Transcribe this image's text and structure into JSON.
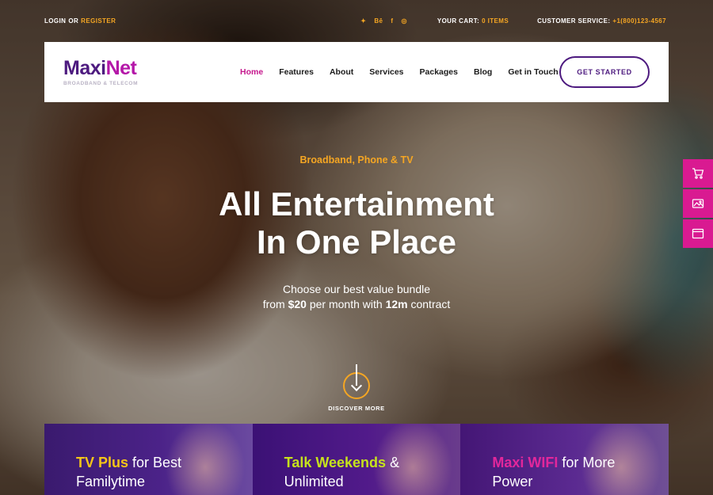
{
  "topbar": {
    "login": "LOGIN",
    "or": "OR",
    "register": "REGISTER",
    "social_icons": [
      "twitter-icon",
      "behance-icon",
      "facebook-icon",
      "instagram-icon"
    ],
    "social_glyphs": [
      "✦",
      "Bē",
      "f",
      "◎"
    ],
    "cart_label": "YOUR CART:",
    "cart_value": "0 ITEMS",
    "service_label": "CUSTOMER SERVICE:",
    "service_value": "+1(800)123-4567"
  },
  "logo": {
    "name_part1": "Maxi",
    "name_part2": "Net",
    "tagline": "BROADBAND & TELECOM"
  },
  "nav": {
    "items": [
      "Home",
      "Features",
      "About",
      "Services",
      "Packages",
      "Blog",
      "Get in Touch"
    ],
    "active": "Home",
    "cta": "GET STARTED"
  },
  "hero": {
    "eyebrow": "Broadband, Phone & TV",
    "headline_line1": "All Entertainment",
    "headline_line2": "In One Place",
    "sub_line1": "Choose our best value bundle",
    "sub_from": "from",
    "sub_price": "$20",
    "sub_mid": "per month with",
    "sub_term": "12m",
    "sub_end": "contract",
    "discover": "DISCOVER MORE"
  },
  "side_buttons": [
    "cart-icon",
    "picture-icon",
    "browser-icon"
  ],
  "cards": [
    {
      "highlight": "TV Plus",
      "rest": "for Best",
      "line2": "Familytime"
    },
    {
      "highlight": "Talk Weekends",
      "rest": "&",
      "line2": "Unlimited"
    },
    {
      "highlight": "Maxi WIFI",
      "rest": "for More",
      "line2": "Power"
    }
  ],
  "colors": {
    "accent_orange": "#f5a623",
    "brand_purple": "#4d1a7f",
    "brand_pink": "#c5178d",
    "side_pink": "#d91a91"
  }
}
